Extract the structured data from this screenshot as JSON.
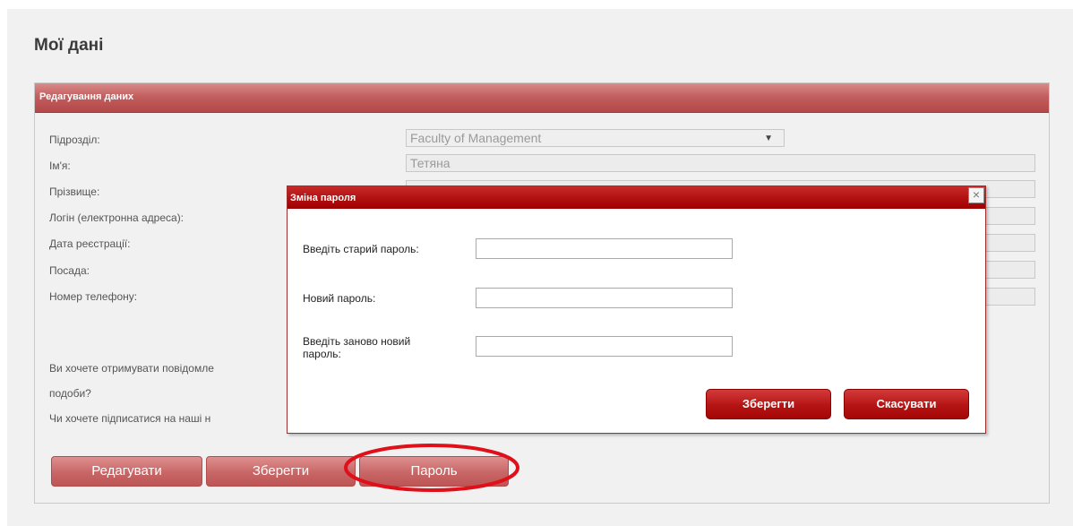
{
  "page": {
    "title": "Мої дані"
  },
  "panel": {
    "header": "Редагування даних",
    "labels": {
      "department": "Підрозділ:",
      "first_name": "Ім'я:",
      "last_name": "Прізвище:",
      "login": "Логін (електронна адреса):",
      "registration_date": "Дата реєстрації:",
      "position": "Посада:",
      "phone": "Номер телефону:"
    },
    "values": {
      "department": "Faculty of Management",
      "first_name": "Тетяна",
      "last_name": "",
      "login": "",
      "registration_date": "",
      "position": "",
      "phone": ""
    },
    "question_notifications_line1": "Ви хочете отримувати повідомле",
    "question_notifications_line2": "подоби?",
    "question_subscribe": "Чи хочете підписатися на наші н",
    "buttons": {
      "edit": "Редагувати",
      "save": "Зберегти",
      "password": "Пароль"
    }
  },
  "modal": {
    "title": "Зміна пароля",
    "old_password_label": "Введіть старий пароль:",
    "new_password_label": "Новий пароль:",
    "repeat_password_label_line1": "Введіть заново новий",
    "repeat_password_label_line2": "пароль:",
    "save_button": "Зберегти",
    "cancel_button": "Скасувати",
    "close_glyph": "×"
  },
  "icons": {
    "dropdown": "chevron-down-icon",
    "close": "close-icon"
  },
  "colors": {
    "header_bg": "#c25f5f",
    "modal_header_bg": "#b11010",
    "annotation": "#e0101a"
  }
}
